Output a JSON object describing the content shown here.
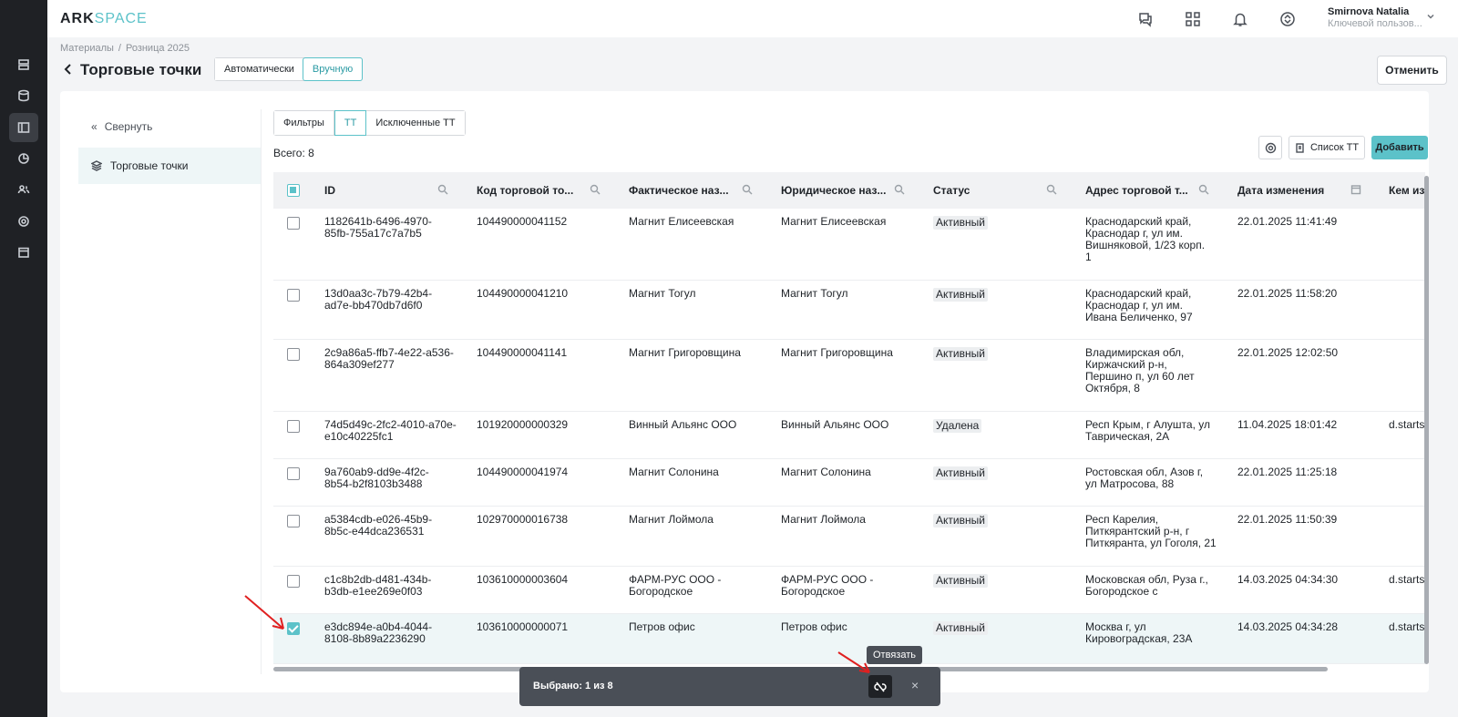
{
  "app": {
    "logo_a": "ARK",
    "logo_b": "SPACE"
  },
  "user": {
    "name": "Smirnova Natalia",
    "role": "Ключевой пользов..."
  },
  "breadcrumb": [
    "Материалы",
    "/",
    "Розница 2025"
  ],
  "page": {
    "title": "Торговые точки",
    "mode_auto": "Автоматически",
    "mode_manual": "Вручную",
    "cancel": "Отменить"
  },
  "side": {
    "collapse": "Свернуть",
    "item": "Торговые точки"
  },
  "tabs": [
    "Фильтры",
    "ТТ",
    "Исключенные ТТ"
  ],
  "toolbar": {
    "total": "Всего: 8",
    "list": "Список ТТ",
    "add": "Добавить"
  },
  "columns": [
    "ID",
    "Код торговой то...",
    "Фактическое наз...",
    "Юридическое наз...",
    "Статус",
    "Адрес торговой т...",
    "Дата изменения",
    "Кем из"
  ],
  "rows": [
    {
      "id": [
        "1182641b-6496-4970-",
        "85fb-755a17c7a7b5"
      ],
      "code": "104490000041152",
      "fact": [
        "Магнит Елисеевская"
      ],
      "legal": [
        "Магнит Елисеевская"
      ],
      "status": "Активный",
      "address": [
        "Краснодарский край,",
        "Краснодар г, ул им.",
        "Вишняковой, 1/23 корп.",
        "1"
      ],
      "date": "22.01.2025 11:41:49",
      "by": "",
      "checked": false
    },
    {
      "id": [
        "13d0aa3c-7b79-42b4-",
        "ad7e-bb470db7d6f0"
      ],
      "code": "104490000041210",
      "fact": [
        "Магнит Тогул"
      ],
      "legal": [
        "Магнит Тогул"
      ],
      "status": "Активный",
      "address": [
        "Краснодарский край,",
        "Краснодар г, ул им.",
        "Ивана Беличенко, 97"
      ],
      "date": "22.01.2025 11:58:20",
      "by": "",
      "checked": false
    },
    {
      "id": [
        "2c9a86a5-ffb7-4e22-a536-",
        "864a309ef277"
      ],
      "code": "104490000041141",
      "fact": [
        "Магнит Григоровщина"
      ],
      "legal": [
        "Магнит Григоровщина"
      ],
      "status": "Активный",
      "address": [
        "Владимирская обл,",
        "Киржачский р-н,",
        "Першино п, ул 60 лет",
        "Октября, 8"
      ],
      "date": "22.01.2025 12:02:50",
      "by": "",
      "checked": false
    },
    {
      "id": [
        "74d5d49c-2fc2-4010-a70e-",
        "e10c40225fc1"
      ],
      "code": "101920000000329",
      "fact": [
        "Винный Альянс ООО"
      ],
      "legal": [
        "Винный Альянс ООО"
      ],
      "status": "Удалена",
      "address": [
        "Респ Крым, г Алушта, ул",
        "Таврическая, 2А"
      ],
      "date": "11.04.2025 18:01:42",
      "by": "d.starts",
      "checked": false
    },
    {
      "id": [
        "9a760ab9-dd9e-4f2c-",
        "8b54-b2f8103b3488"
      ],
      "code": "104490000041974",
      "fact": [
        "Магнит Солонина"
      ],
      "legal": [
        "Магнит Солонина"
      ],
      "status": "Активный",
      "address": [
        "Ростовская обл, Азов г,",
        "ул Матросова, 88"
      ],
      "date": "22.01.2025 11:25:18",
      "by": "",
      "checked": false
    },
    {
      "id": [
        "a5384cdb-e026-45b9-",
        "8b5c-e44dca236531"
      ],
      "code": "102970000016738",
      "fact": [
        "Магнит Лоймола"
      ],
      "legal": [
        "Магнит Лоймола"
      ],
      "status": "Активный",
      "address": [
        "Респ Карелия,",
        "Питкярантский р-н, г",
        "Питкяранта, ул Гоголя, 21"
      ],
      "date": "22.01.2025 11:50:39",
      "by": "",
      "checked": false
    },
    {
      "id": [
        "c1c8b2db-d481-434b-",
        "b3db-e1ee269e0f03"
      ],
      "code": "103610000003604",
      "fact": [
        "ФАРМ-РУС ООО -",
        "Богородское"
      ],
      "legal": [
        "ФАРМ-РУС ООО -",
        "Богородское"
      ],
      "status": "Активный",
      "address": [
        "Московская обл, Руза г.,",
        "Богородское с"
      ],
      "date": "14.03.2025 04:34:30",
      "by": "d.starts",
      "checked": false
    },
    {
      "id": [
        "e3dc894e-a0b4-4044-",
        "8108-8b89a2236290"
      ],
      "code": "103610000000071",
      "fact": [
        "Петров офис"
      ],
      "legal": [
        "Петров офис"
      ],
      "status": "Активный",
      "address": [
        "Москва г, ул",
        "Кировоградская, 23А"
      ],
      "date": "14.03.2025 04:34:28",
      "by": "d.starts",
      "checked": true
    }
  ],
  "selection": {
    "text": "Выбрано: 1 из 8",
    "tooltip": "Отвязать",
    "close": "×"
  },
  "colors": {
    "accent": "#5cc2c9",
    "sidebar": "#1f2125",
    "bar": "#4a4f57",
    "annotation_arrow": "#e02020"
  }
}
